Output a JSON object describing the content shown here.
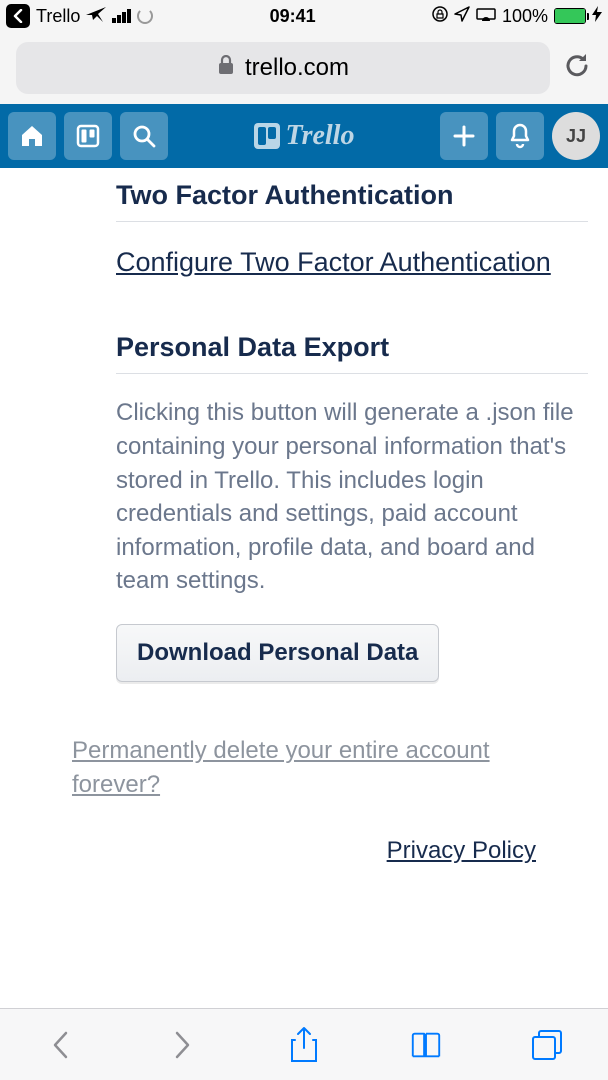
{
  "status_bar": {
    "app_name": "Trello",
    "time": "09:41",
    "battery_pct": "100%"
  },
  "browser": {
    "url": "trello.com"
  },
  "header": {
    "avatar_initials": "JJ"
  },
  "sections": {
    "twofa": {
      "title": "Two Factor Authentication",
      "configure_link": "Configure Two Factor Authentication"
    },
    "export": {
      "title": "Personal Data Export",
      "description": "Clicking this button will generate a .json file containing your personal information that's stored in Trello. This includes login credentials and settings, paid account information, profile data, and board and team settings.",
      "button_label": "Download Personal Data"
    },
    "delete_link": "Permanently delete your entire account forever?",
    "privacy_link": "Privacy Policy"
  }
}
